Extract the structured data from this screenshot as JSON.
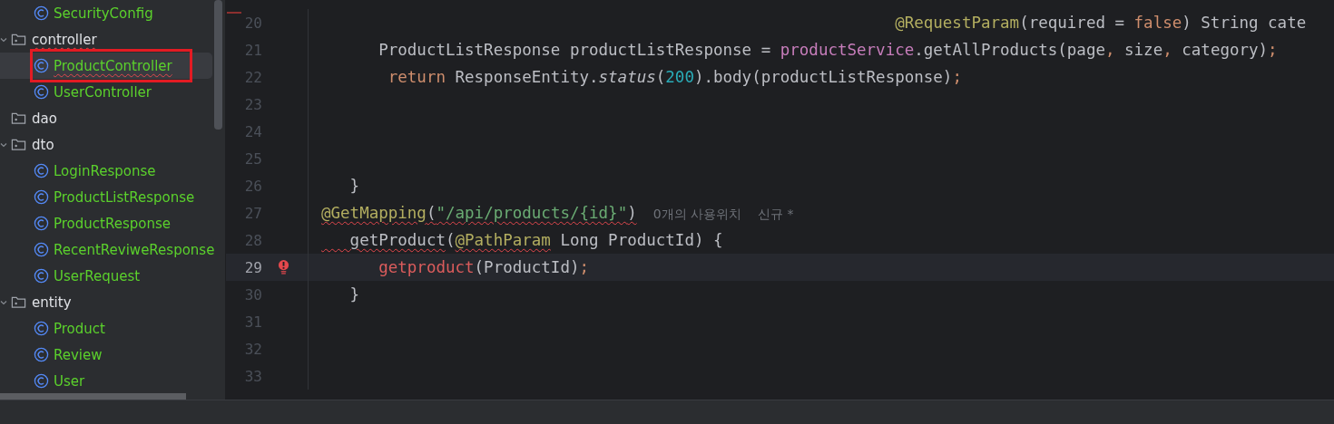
{
  "project_tree": [
    {
      "kind": "class",
      "name": "SecurityConfig",
      "selected": false,
      "error": false,
      "annotated": false
    },
    {
      "kind": "folder",
      "name": "controller",
      "expanded": true,
      "selected": false,
      "error": true,
      "annotated": false,
      "children": [
        {
          "kind": "class",
          "name": "ProductController",
          "selected": true,
          "error": true,
          "annotated": true
        },
        {
          "kind": "class",
          "name": "UserController",
          "selected": false,
          "error": false,
          "annotated": false
        }
      ]
    },
    {
      "kind": "folder",
      "name": "dao",
      "expanded": false,
      "selected": false,
      "error": false,
      "annotated": false
    },
    {
      "kind": "folder",
      "name": "dto",
      "expanded": true,
      "selected": false,
      "error": false,
      "annotated": false,
      "children": [
        {
          "kind": "class",
          "name": "LoginResponse",
          "selected": false,
          "error": false,
          "annotated": false
        },
        {
          "kind": "class",
          "name": "ProductListResponse",
          "selected": false,
          "error": false,
          "annotated": false
        },
        {
          "kind": "class",
          "name": "ProductResponse",
          "selected": false,
          "error": false,
          "annotated": false
        },
        {
          "kind": "class",
          "name": "RecentReviweResponse",
          "selected": false,
          "error": false,
          "annotated": false
        },
        {
          "kind": "class",
          "name": "UserRequest",
          "selected": false,
          "error": false,
          "annotated": false
        }
      ]
    },
    {
      "kind": "folder",
      "name": "entity",
      "expanded": true,
      "selected": false,
      "error": false,
      "annotated": false,
      "children": [
        {
          "kind": "class",
          "name": "Product",
          "selected": false,
          "error": false,
          "annotated": false
        },
        {
          "kind": "class",
          "name": "Review",
          "selected": false,
          "error": false,
          "annotated": false
        },
        {
          "kind": "class",
          "name": "User",
          "selected": false,
          "error": false,
          "annotated": false
        }
      ]
    }
  ],
  "editor": {
    "lines": [
      {
        "number": "20",
        "current": false,
        "error_icon": false,
        "tokens": [
          {
            "text": "                                                            @RequestParam",
            "kind": "annotation"
          },
          {
            "text": "(required = ",
            "kind": "plain"
          },
          {
            "text": "false",
            "kind": "keyword"
          },
          {
            "text": ") String cate",
            "kind": "plain"
          }
        ]
      },
      {
        "number": "21",
        "current": false,
        "error_icon": false,
        "tokens": [
          {
            "text": "      ProductListResponse productListResponse = ",
            "kind": "plain"
          },
          {
            "text": "productService",
            "kind": "field"
          },
          {
            "text": ".getAllProducts(page",
            "kind": "plain"
          },
          {
            "text": ",",
            "kind": "keyword"
          },
          {
            "text": " size",
            "kind": "plain"
          },
          {
            "text": ",",
            "kind": "keyword"
          },
          {
            "text": " category)",
            "kind": "plain"
          },
          {
            "text": ";",
            "kind": "keyword"
          }
        ]
      },
      {
        "number": "22",
        "current": false,
        "error_icon": false,
        "tokens": [
          {
            "text": "       return",
            "kind": "keyword"
          },
          {
            "text": " ResponseEntity.",
            "kind": "plain"
          },
          {
            "text": "status",
            "kind": "static"
          },
          {
            "text": "(",
            "kind": "plain"
          },
          {
            "text": "200",
            "kind": "number"
          },
          {
            "text": ").body(productListResponse)",
            "kind": "plain"
          },
          {
            "text": ";",
            "kind": "keyword"
          }
        ]
      },
      {
        "number": "23",
        "current": false,
        "error_icon": false
      },
      {
        "number": "24",
        "current": false,
        "error_icon": false
      },
      {
        "number": "25",
        "current": false,
        "error_icon": false
      },
      {
        "number": "26",
        "current": false,
        "error_icon": false,
        "tokens": [
          {
            "text": "   }",
            "kind": "plain"
          }
        ]
      },
      {
        "number": "27",
        "current": false,
        "error_icon": false,
        "tokens": [
          {
            "text": "@GetMapping",
            "kind": "annotation",
            "squiggle": true
          },
          {
            "text": "(",
            "kind": "plain",
            "squiggle": true
          },
          {
            "text": "\"/api/products/{id}\"",
            "kind": "string",
            "squiggle": true
          },
          {
            "text": ")",
            "kind": "plain",
            "squiggle": true
          }
        ],
        "hints": [
          "0개의 사용위치",
          "신규 *"
        ]
      },
      {
        "number": "28",
        "current": false,
        "error_icon": false,
        "tokens": [
          {
            "text": "   getProduct",
            "kind": "plain",
            "squiggle": true
          },
          {
            "text": "(",
            "kind": "plain"
          },
          {
            "text": "@PathParam",
            "kind": "annotation",
            "squiggle": true
          },
          {
            "text": " Long ProductId) {",
            "kind": "plain"
          }
        ]
      },
      {
        "number": "29",
        "current": true,
        "error_icon": true,
        "tokens": [
          {
            "text": "      getproduct",
            "kind": "error"
          },
          {
            "text": "(ProductId)",
            "kind": "plain"
          },
          {
            "text": ";",
            "kind": "keyword"
          }
        ]
      },
      {
        "number": "30",
        "current": false,
        "error_icon": false,
        "tokens": [
          {
            "text": "   }",
            "kind": "plain"
          }
        ]
      },
      {
        "number": "31",
        "current": false,
        "error_icon": false
      },
      {
        "number": "32",
        "current": false,
        "error_icon": false
      },
      {
        "number": "33",
        "current": false,
        "error_icon": false
      }
    ]
  }
}
